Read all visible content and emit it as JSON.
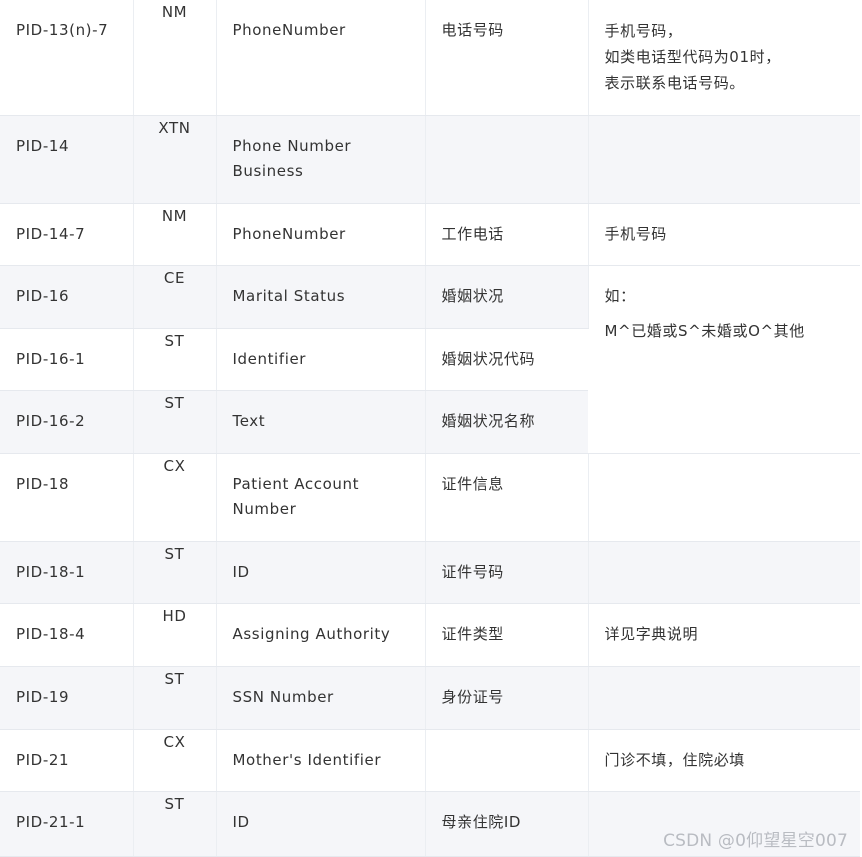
{
  "rows": [
    {
      "id": "PID-13(n)-7",
      "type": "NM",
      "name": "PhoneNumber",
      "desc": "电话号码",
      "remark": [
        "手机号码，",
        "如类电话型代码为01时，",
        "表示联系电话号码。"
      ]
    },
    {
      "id": "PID-14",
      "type": "XTN",
      "name_lines": [
        "Phone Number",
        "Business"
      ],
      "desc": "",
      "remark": ""
    },
    {
      "id": "PID-14-7",
      "type": "NM",
      "name": "PhoneNumber",
      "desc": "工作电话",
      "remark": "手机号码"
    },
    {
      "id": "PID-16",
      "type": "CE",
      "name": "Marital Status",
      "desc": "婚姻状况",
      "remark": [
        "如：",
        "M^已婚或S^未婚或O^其他"
      ]
    },
    {
      "id": "PID-16-1",
      "type": "ST",
      "name": "Identifier",
      "desc": "婚姻状况代码"
    },
    {
      "id": "PID-16-2",
      "type": "ST",
      "name": "Text",
      "desc": "婚姻状况名称"
    },
    {
      "id": "PID-18",
      "type": "CX",
      "name_lines": [
        "Patient Account",
        "Number"
      ],
      "desc": "证件信息",
      "remark": ""
    },
    {
      "id": "PID-18-1",
      "type": "ST",
      "name": "ID",
      "desc": "证件号码",
      "remark": ""
    },
    {
      "id": "PID-18-4",
      "type": "HD",
      "name": "Assigning Authority",
      "desc": "证件类型",
      "remark": "详见字典说明"
    },
    {
      "id": "PID-19",
      "type": "ST",
      "name": "SSN Number",
      "desc": "身份证号",
      "remark": ""
    },
    {
      "id": "PID-21",
      "type": "CX",
      "name": "Mother's Identifier",
      "desc": "",
      "remark": "门诊不填，住院必填"
    },
    {
      "id": "PID-21-1",
      "type": "ST",
      "name": "ID",
      "desc": "母亲住院ID",
      "remark": ""
    }
  ],
  "watermark": "CSDN @0仰望星空007"
}
